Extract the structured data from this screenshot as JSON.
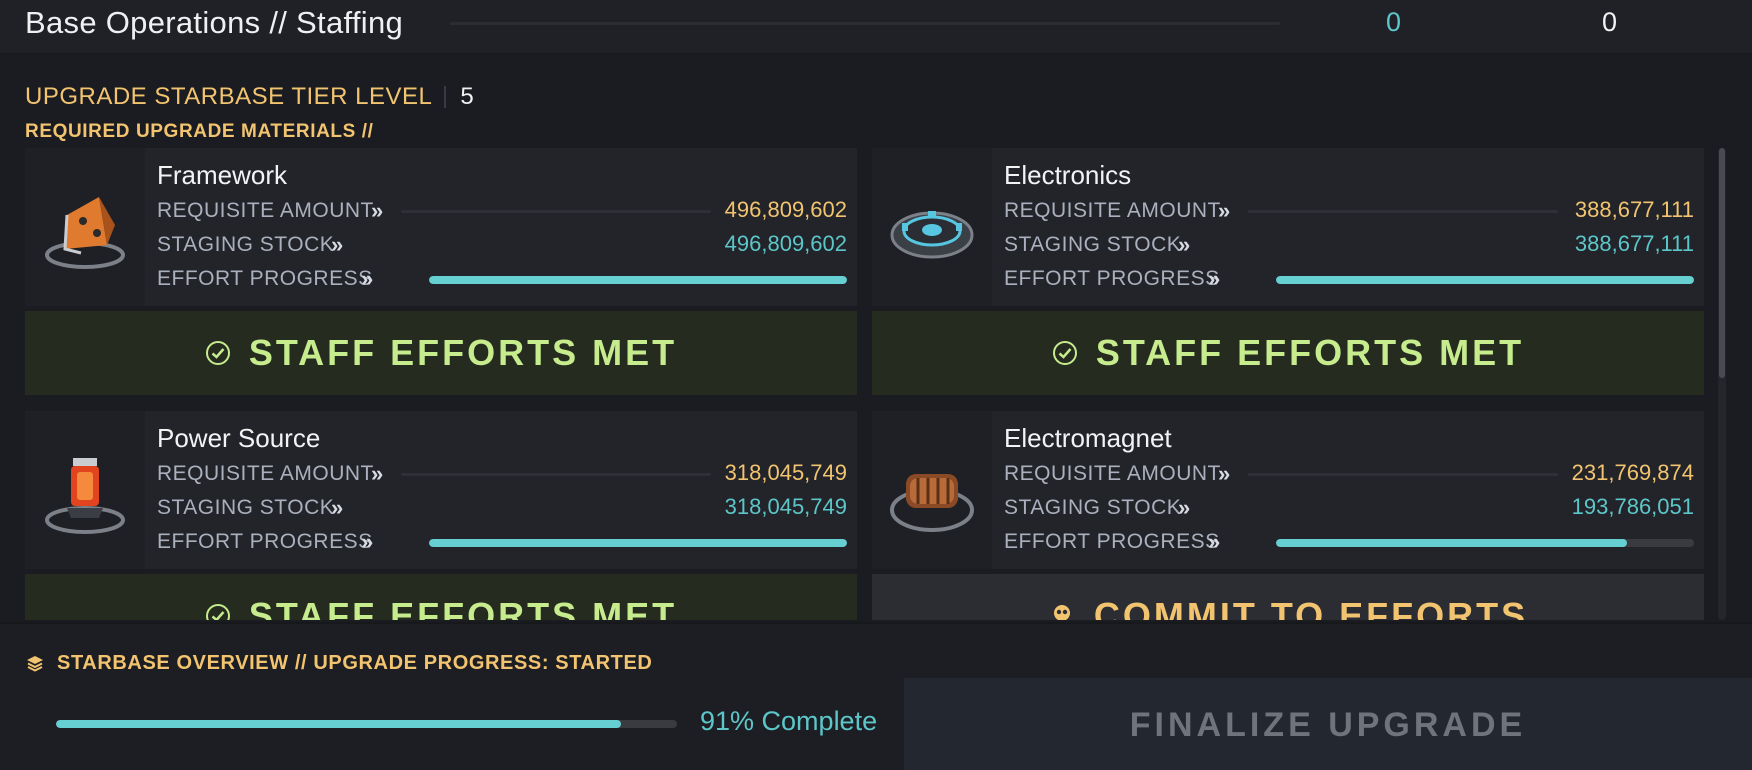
{
  "header": {
    "title": "Base Operations // Staffing",
    "value_a": "0",
    "value_b": "0"
  },
  "tier": {
    "label": "UPGRADE STARBASE TIER LEVEL",
    "level": "5"
  },
  "required_label": "REQUIRED UPGRADE MATERIALS //",
  "labels": {
    "requisite": "REQUISITE AMOUNT",
    "staging": "STAGING STOCK",
    "effort": "EFFORT PROGRESS",
    "chevron": "»"
  },
  "materials": [
    {
      "name": "Framework",
      "icon": "framework-icon",
      "requisite": "496,809,602",
      "staging": "496,809,602",
      "progress": 1.0,
      "status": "met",
      "action_label": "STAFF EFFORTS MET"
    },
    {
      "name": "Electronics",
      "icon": "electronics-icon",
      "requisite": "388,677,111",
      "staging": "388,677,111",
      "progress": 1.0,
      "status": "met",
      "action_label": "STAFF EFFORTS MET"
    },
    {
      "name": "Power Source",
      "icon": "power-source-icon",
      "requisite": "318,045,749",
      "staging": "318,045,749",
      "progress": 1.0,
      "status": "met",
      "action_label": "STAFF EFFORTS MET"
    },
    {
      "name": "Electromagnet",
      "icon": "electromagnet-icon",
      "requisite": "231,769,874",
      "staging": "193,786,051",
      "progress": 0.84,
      "status": "commit",
      "action_label": "COMMIT TO EFFORTS"
    }
  ],
  "overview": {
    "title": "STARBASE OVERVIEW // UPGRADE PROGRESS: STARTED",
    "progress": 0.91,
    "progress_label": "91% Complete",
    "finalize_label": "FINALIZE UPGRADE"
  },
  "colors": {
    "gold": "#f2c46f",
    "teal": "#5cc6c9",
    "met_green": "#c6ec8d"
  }
}
